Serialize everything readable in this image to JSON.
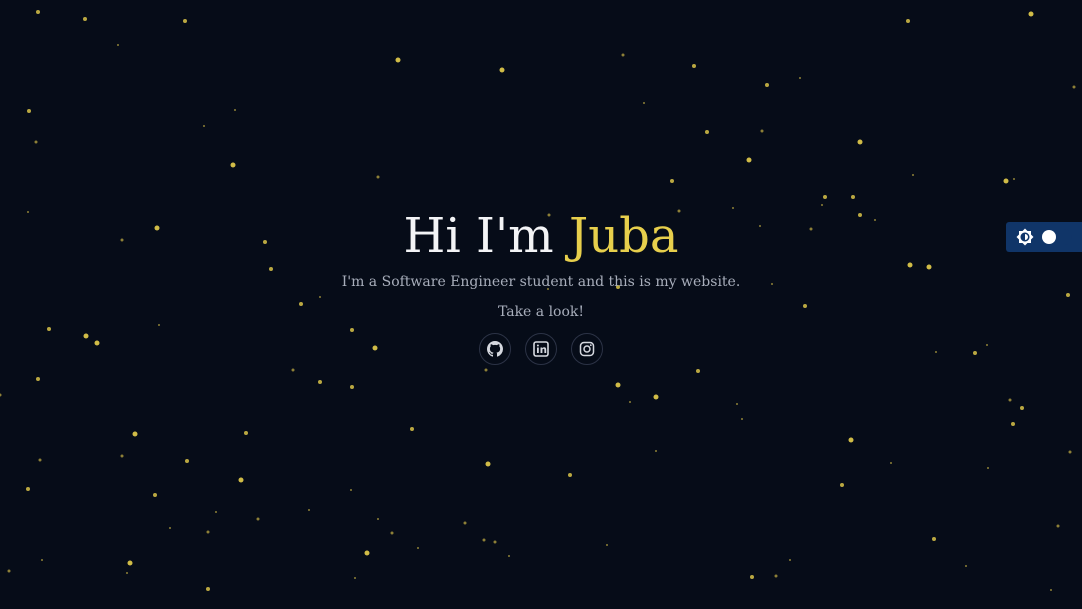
{
  "page": {
    "background_color": "#060c18",
    "star_color": "#e7cf4c"
  },
  "hero": {
    "greeting": "Hi I'm ",
    "name": "Juba",
    "subtitle": "I'm a Software Engineer student and this is my website.",
    "tagline": "Take a look!"
  },
  "socials": [
    {
      "icon": "github-icon",
      "label": "GitHub"
    },
    {
      "icon": "linkedin-icon",
      "label": "LinkedIn"
    },
    {
      "icon": "instagram-icon",
      "label": "Instagram"
    }
  ],
  "theme_toggle": {
    "icon": "brightness-icon",
    "state": "dark",
    "background_color": "#103568"
  }
}
